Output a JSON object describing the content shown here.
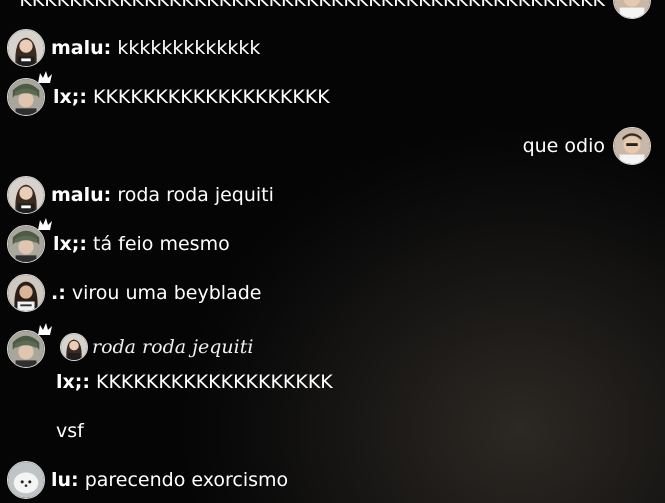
{
  "messages": [
    {
      "text": "KKKKKKKKKKKKKKKKKKKKKKKKKKKKKKKKKKKKKKKKKKKKKKK"
    },
    {
      "user": "malu:",
      "text": "kkkkkkkkkkkkk"
    },
    {
      "user": "lx;:",
      "text": "KKKKKKKKKKKKKKKKKKK"
    },
    {
      "text": "que odio"
    },
    {
      "user": "malu:",
      "text": "roda roda jequiti"
    },
    {
      "user": "lx;:",
      "text": "tá feio mesmo"
    },
    {
      "user": ".:",
      "text": "virou uma beyblade"
    },
    {
      "reply_quote": "roda roda jequiti",
      "user": "lx;:",
      "text": "KKKKKKKKKKKKKKKKKKK"
    },
    {
      "text": "vsf"
    },
    {
      "user": "lu:",
      "text": "parecendo exorcismo"
    }
  ],
  "colors": {
    "text": "#ffffff",
    "avatar_ring": "#d9d9d9",
    "background": "#0b0b0b"
  }
}
